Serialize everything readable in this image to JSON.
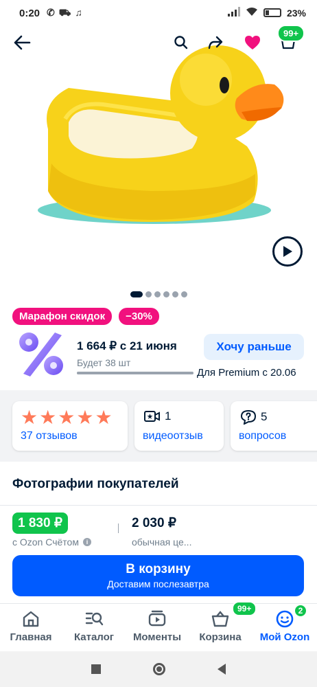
{
  "status_bar": {
    "time": "0:20",
    "left_icons": [
      "phone-icon",
      "stroller-icon",
      "music-icon"
    ],
    "battery": "23%"
  },
  "header": {
    "icons": [
      "back-arrow-icon",
      "search-icon",
      "share-icon",
      "heart-icon",
      "cart-icon"
    ],
    "cart_badge": "99+"
  },
  "gallery": {
    "total_images": 6,
    "active_index": 0
  },
  "promo": {
    "marathon": "Марафон скидок",
    "discount": "−30%"
  },
  "future_offer": {
    "price_line": "1 664 ₽ с 21 июня",
    "stock_line": "Будет 38 шт",
    "stock_fraction": 1.0,
    "want_button": "Хочу раньше",
    "premium_line": "Для Premium с 20.06"
  },
  "info_cards": {
    "reviews": {
      "rating": 5,
      "label": "37 отзывов"
    },
    "video": {
      "count": "1",
      "label": "видеоотзыв"
    },
    "questions": {
      "count": "5",
      "label": "вопросов"
    }
  },
  "photos": {
    "title": "Фотографии покупателей"
  },
  "pricing": {
    "ozon_price": "1 830 ₽",
    "ozon_caption": "с Ozon Счётом",
    "regular_price": "2 030 ₽",
    "regular_caption": "обычная це..."
  },
  "cart_button": {
    "label": "В корзину",
    "sub": "Доставим послезавтра"
  },
  "bottom_nav": {
    "items": [
      {
        "label": "Главная",
        "icon": "home-icon"
      },
      {
        "label": "Каталог",
        "icon": "catalog-icon"
      },
      {
        "label": "Моменты",
        "icon": "moments-icon"
      },
      {
        "label": "Корзина",
        "icon": "basket-icon"
      },
      {
        "label": "Мой Ozon",
        "icon": "smile-icon"
      }
    ],
    "cart_badge": "99+",
    "my_badge": "2",
    "active_index": 4
  },
  "colors": {
    "brand_blue": "#005bff",
    "promo_pink": "#f1117e",
    "ozon_green": "#10c44c",
    "star_orange": "#ff7a59"
  }
}
